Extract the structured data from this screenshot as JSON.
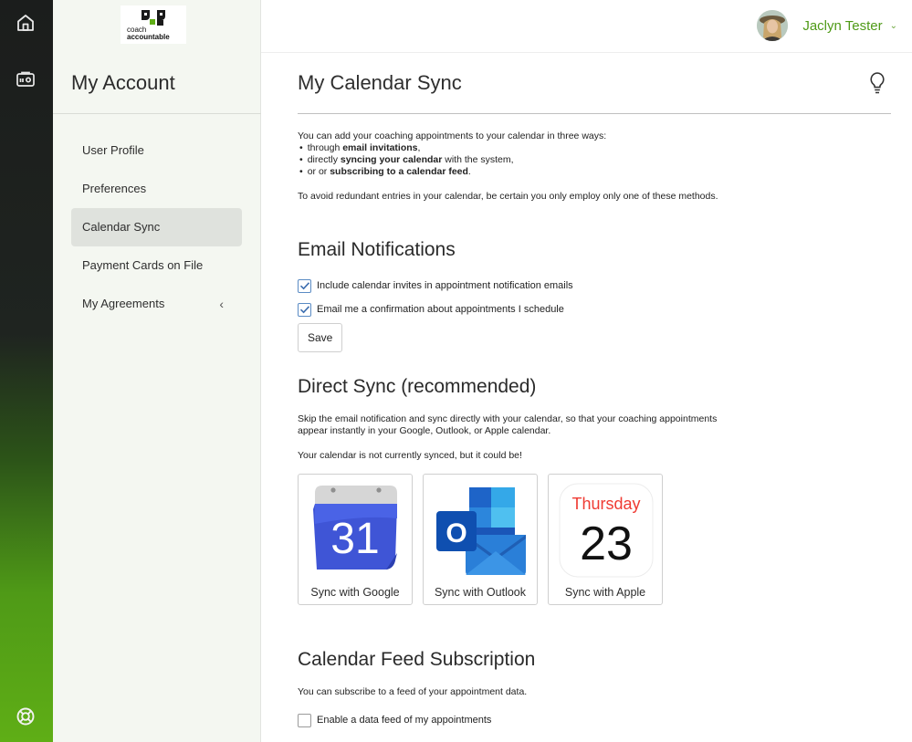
{
  "brand": {
    "logo_line1": "coach",
    "logo_line2": "accountable",
    "accent": "#4f9a17"
  },
  "rail": {
    "icons": [
      "home-icon",
      "id-card-icon",
      "help-lifebuoy-icon"
    ]
  },
  "sidebar": {
    "title": "My Account",
    "items": [
      {
        "label": "User Profile"
      },
      {
        "label": "Preferences"
      },
      {
        "label": "Calendar Sync",
        "active": true
      },
      {
        "label": "Payment Cards on File"
      },
      {
        "label": "My Agreements",
        "chevron": "‹"
      }
    ]
  },
  "header": {
    "user_name": "Jaclyn Tester",
    "caret": "⌄"
  },
  "main": {
    "title": "My Calendar Sync",
    "intro": {
      "lead": "You can add your coaching appointments to your calendar in three ways:",
      "b1_pre": "through ",
      "b1_bold": "email invitations",
      "b1_post": ",",
      "b2_pre": "directly ",
      "b2_bold": "syncing your calendar",
      "b2_post": " with the system,",
      "b3_pre": "or or ",
      "b3_bold": "subscribing to a calendar feed",
      "b3_post": ".",
      "note": "To avoid redundant entries in your calendar, be certain you only employ only one of these methods."
    },
    "email": {
      "heading": "Email Notifications",
      "opt1": "Include calendar invites in appointment notification emails",
      "opt1_checked": true,
      "opt2": "Email me a confirmation about appointments I schedule",
      "opt2_checked": true,
      "save": "Save"
    },
    "direct": {
      "heading": "Direct Sync (recommended)",
      "desc": "Skip the email notification and sync directly with your calendar, so that your coaching appointments appear instantly in your Google, Outlook, or Apple calendar.",
      "status": "Your calendar is not currently synced, but it could be!",
      "cards": [
        {
          "label": "Sync with Google",
          "icon": "google-calendar-icon",
          "day": "31"
        },
        {
          "label": "Sync with Outlook",
          "icon": "outlook-icon",
          "letter": "O"
        },
        {
          "label": "Sync with Apple",
          "icon": "apple-calendar-icon",
          "weekday": "Thursday",
          "day": "23"
        }
      ]
    },
    "feed": {
      "heading": "Calendar Feed Subscription",
      "desc": "You can subscribe to a feed of your appointment data.",
      "opt": "Enable a data feed of my appointments",
      "opt_checked": false
    }
  }
}
